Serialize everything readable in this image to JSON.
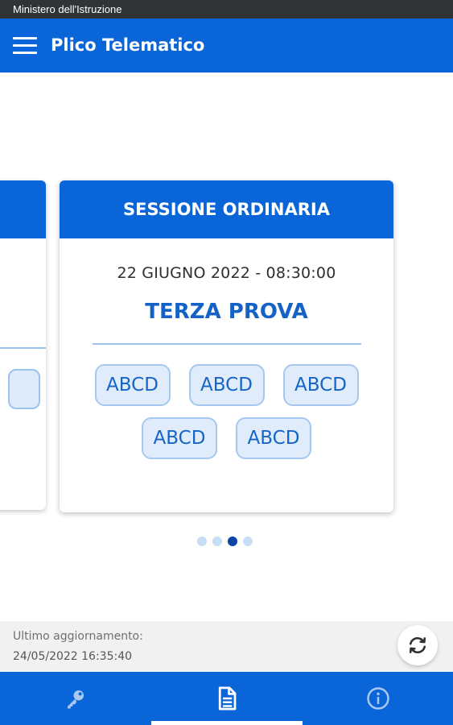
{
  "status_bar": {
    "text": "Ministero dell'Istruzione"
  },
  "app_bar": {
    "title": "Plico Telematico",
    "menu_icon": "hamburger-menu-icon"
  },
  "card": {
    "header": "SESSIONE ORDINARIA",
    "date": "22 GIUGNO 2022 - 08:30:00",
    "subject": "TERZA PROVA",
    "codes": [
      "ABCD",
      "ABCD",
      "ABCD",
      "ABCD",
      "ABCD"
    ]
  },
  "pagination": {
    "total": 4,
    "active_index": 3
  },
  "update": {
    "label": "Ultimo aggiornamento:",
    "timestamp": "24/05/2022 16:35:40",
    "refresh_icon": "refresh-icon"
  },
  "bottom_nav": {
    "items": [
      {
        "icon": "key-icon",
        "active": false
      },
      {
        "icon": "document-icon",
        "active": true
      },
      {
        "icon": "info-icon",
        "active": false
      }
    ]
  },
  "colors": {
    "primary": "#0a66d8",
    "chip_bg": "#e1ecfb",
    "chip_text": "#1565c8",
    "status_bar": "#303437"
  }
}
